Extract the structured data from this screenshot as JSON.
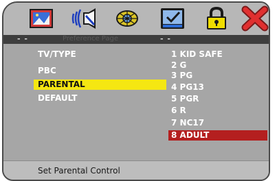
{
  "toolbar": {
    "icons": [
      {
        "name": "language-setup-icon",
        "color": "#d23b3b"
      },
      {
        "name": "audio-setup-icon",
        "color": "#1e3fbf"
      },
      {
        "name": "video-setup-icon",
        "color": "#d9c326"
      },
      {
        "name": "preference-icon",
        "color": "#2b6bd6"
      },
      {
        "name": "password-lock-icon",
        "color": "#f0dd00"
      },
      {
        "name": "exit-icon",
        "color": "#e03030"
      }
    ]
  },
  "page_bar": {
    "dash_left": "- -",
    "title": "Preference Page",
    "dash_right": "- -"
  },
  "menu": {
    "left_items": [
      "TV/TYPE",
      "PBC",
      "PARENTAL",
      "DEFAULT"
    ],
    "selected_left": "PARENTAL",
    "right_items": [
      "1 KID SAFE",
      "2 G",
      "3 PG",
      "4 PG13",
      "5 PGR",
      "6 R",
      "7 NC17",
      "8 ADULT"
    ],
    "selected_right": "8 ADULT"
  },
  "status": {
    "text": "Set Parental Control"
  },
  "colors": {
    "panel": "#a6a6a6",
    "highlight_left": "#f5e712",
    "highlight_right": "#b41f1f"
  }
}
